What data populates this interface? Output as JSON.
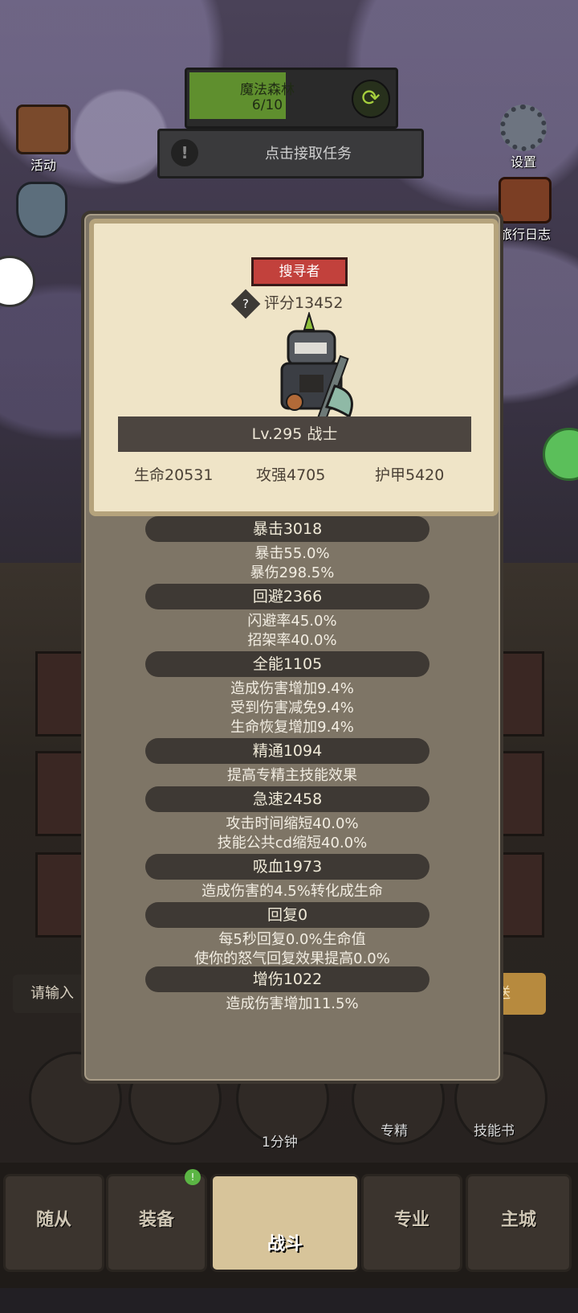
{
  "hud": {
    "stage_name": "魔法森林",
    "stage_progress": "6/10",
    "stage_progress_fraction": 0.6,
    "quest_text": "点击接取任务",
    "quest_icon": "!",
    "activity_label": "活动",
    "settings_label": "设置",
    "travel_log_label": "旅行日志"
  },
  "dialog": {
    "role_badge": "搜寻者",
    "help_icon": "?",
    "score": "评分13452",
    "level": "Lv.295 战士",
    "base_stats": [
      "生命20531",
      "攻强4705",
      "护甲5420"
    ],
    "attributes": [
      {
        "title": "暴击3018",
        "lines": [
          "暴击55.0%",
          "暴伤298.5%"
        ]
      },
      {
        "title": "回避2366",
        "lines": [
          "闪避率45.0%",
          "招架率40.0%"
        ]
      },
      {
        "title": "全能1105",
        "lines": [
          "造成伤害增加9.4%",
          "受到伤害减免9.4%",
          "生命恢复增加9.4%"
        ]
      },
      {
        "title": "精通1094",
        "lines": [
          "提高专精主技能效果"
        ]
      },
      {
        "title": "急速2458",
        "lines": [
          "攻击时间缩短40.0%",
          "技能公共cd缩短40.0%"
        ]
      },
      {
        "title": "吸血1973",
        "lines": [
          "造成伤害的4.5%转化成生命"
        ]
      },
      {
        "title": "回复0",
        "lines": [
          "每5秒回复0.0%生命值",
          "使你的怒气回复效果提高0.0%"
        ]
      },
      {
        "title": "增伤1022",
        "lines": [
          "造成伤害增加11.5%"
        ]
      }
    ]
  },
  "chat": {
    "input_placeholder": "请输入",
    "send_label": "送"
  },
  "abilities": {
    "timer_label": "1分钟",
    "specialty_label": "专精",
    "skill_book_label": "技能书"
  },
  "nav": {
    "tabs": [
      "随从",
      "装备",
      "战斗",
      "专业",
      "主城"
    ],
    "active": "战斗",
    "equipment_badge": "!"
  },
  "colors": {
    "stage_fill": "#5f8f2e",
    "role_badge": "#c2413c",
    "dialog_bg": "#7e7566",
    "card_bg": "#efe4c7"
  }
}
